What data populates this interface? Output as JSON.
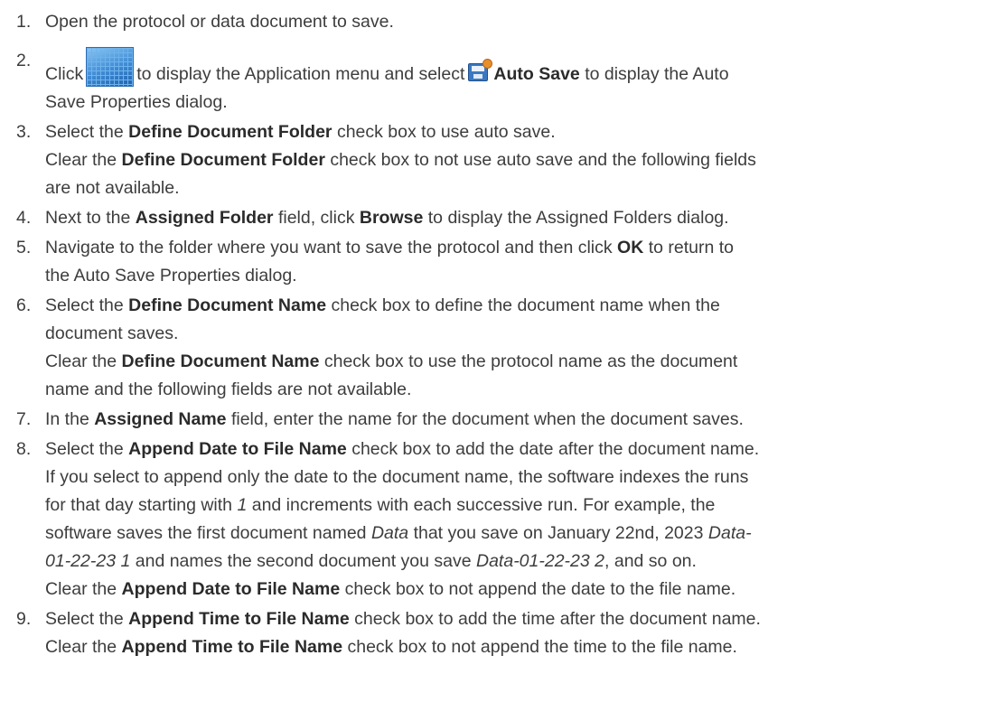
{
  "steps": [
    {
      "number": "1.",
      "t1": "Open the protocol or data document to save."
    },
    {
      "number": "2.",
      "t_click": "Click",
      "app_menu_icon": "application-menu-icon",
      "t_display": "to display the Application menu and select",
      "autosave_icon": "auto-save-icon",
      "b_auto_save": "Auto Save",
      "t_to_display": "to display the Auto",
      "t_line2": "Save Properties dialog."
    },
    {
      "number": "3.",
      "p1_a": "Select the",
      "p1_b": "Define Document Folder",
      "p1_c": "check box to use auto save.",
      "p2_a": "Clear the",
      "p2_b": "Define Document Folder",
      "p2_c": "check box to not use auto save and the following fields",
      "p2_d": "are not available."
    },
    {
      "number": "4.",
      "a": "Next to the",
      "b": "Assigned Folder",
      "c": "field, click",
      "d": "Browse",
      "e": "to display the Assigned Folders dialog."
    },
    {
      "number": "5.",
      "a": "Navigate to the folder where you want to save the protocol and then click",
      "b": "OK",
      "c": "to return to",
      "d": "the Auto Save Properties dialog."
    },
    {
      "number": "6.",
      "p1_a": "Select the",
      "p1_b": "Define Document Name",
      "p1_c": "check box to define the document name when the",
      "p1_d": "document saves.",
      "p2_a": "Clear the",
      "p2_b": "Define Document Name",
      "p2_c": "check box to use the protocol name as the document",
      "p2_d": "name and the following fields are not available."
    },
    {
      "number": "7.",
      "a": "In the",
      "b": "Assigned Name",
      "c": "field, enter the name for the document when the document saves."
    },
    {
      "number": "8.",
      "p1_a": "Select the",
      "p1_b": "Append Date to File Name",
      "p1_c": "check box to add the date after the document name.",
      "p2_a": "If you select to append only the date to the document name, the software indexes the runs",
      "p2_b": "for that day starting with",
      "p2_c": "1",
      "p2_d": "and increments with each successive run. For example, the",
      "p2_e": "software saves the first document named",
      "p2_f": "Data",
      "p2_g": "that you save on January 22nd, 2023",
      "p2_h": "Data-",
      "p2_i": "01-22-23 1",
      "p2_j": "and names the second document you save",
      "p2_k": "Data-01-22-23 2",
      "p2_l": ", and so on.",
      "p3_a": "Clear the",
      "p3_b": "Append Date to File Name",
      "p3_c": "check box to not append the date to the file name."
    },
    {
      "number": "9.",
      "p1_a": "Select the",
      "p1_b": "Append Time to File Name",
      "p1_c": "check box to add the time after the document name.",
      "p2_a": "Clear the",
      "p2_b": "Append Time to File Name",
      "p2_c": "check box to not append the time to the file name."
    }
  ]
}
